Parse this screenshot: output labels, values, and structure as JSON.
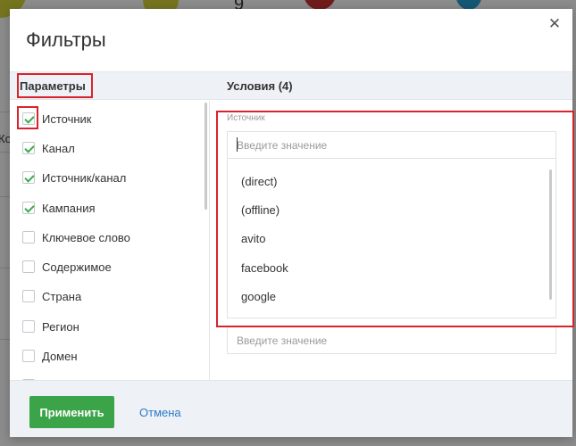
{
  "background": {
    "number_top": "9",
    "fragment_left": "Ко"
  },
  "modal": {
    "title": "Фильтры",
    "close_icon": "close-icon",
    "params_header": "Параметры",
    "conditions_header": "Условия (4)",
    "parameters": [
      {
        "label": "Источник",
        "checked": true
      },
      {
        "label": "Канал",
        "checked": true
      },
      {
        "label": "Источник/канал",
        "checked": true
      },
      {
        "label": "Кампания",
        "checked": true
      },
      {
        "label": "Ключевое слово",
        "checked": false
      },
      {
        "label": "Содержимое",
        "checked": false
      },
      {
        "label": "Страна",
        "checked": false
      },
      {
        "label": "Регион",
        "checked": false
      },
      {
        "label": "Домен",
        "checked": false
      }
    ],
    "condition": {
      "label": "Источник",
      "placeholder": "Введите значение",
      "options": [
        "(direct)",
        "(offline)",
        "avito",
        "facebook",
        "google"
      ]
    },
    "second_input": {
      "placeholder": "Введите значение"
    },
    "footer": {
      "apply_label": "Применить",
      "cancel_label": "Отмена"
    }
  },
  "colors": {
    "accent_green": "#3ba449",
    "link_blue": "#2e79c9",
    "highlight_red": "#d9232b"
  }
}
